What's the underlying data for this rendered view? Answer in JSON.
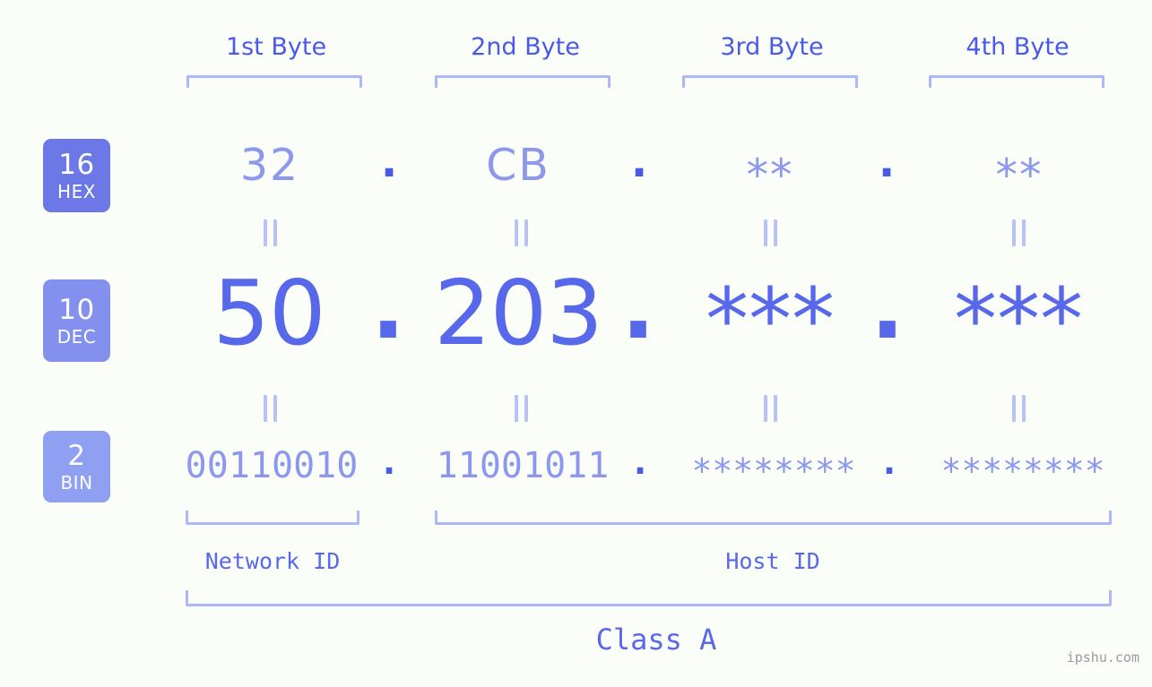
{
  "background_color": "#fbfdf8",
  "colors": {
    "accent_strong": "#4a5ae8",
    "accent_mid": "#5868ea",
    "accent_light": "#8c98ec",
    "bracket": "#aeb8f8",
    "badge_hex": "#6c78e6",
    "badge_dec": "#8490ee",
    "badge_bin": "#8fa0f3",
    "watermark": "#9a9aa2"
  },
  "byte_headers": [
    {
      "label": "1st Byte"
    },
    {
      "label": "2nd Byte"
    },
    {
      "label": "3rd Byte"
    },
    {
      "label": "4th Byte"
    }
  ],
  "rows": {
    "hex": {
      "badge_number": "16",
      "badge_system": "HEX",
      "values": [
        "32",
        "CB",
        "**",
        "**"
      ],
      "separators": [
        ".",
        ".",
        "."
      ]
    },
    "dec": {
      "badge_number": "10",
      "badge_system": "DEC",
      "values": [
        "50",
        "203",
        "***",
        "***"
      ],
      "separators": [
        ".",
        ".",
        "."
      ]
    },
    "bin": {
      "badge_number": "2",
      "badge_system": "BIN",
      "values": [
        "00110010",
        "11001011",
        "********",
        "********"
      ],
      "separators": [
        ".",
        ".",
        "."
      ]
    }
  },
  "equals_symbol": "=",
  "id_labels": {
    "network": "Network ID",
    "host": "Host ID"
  },
  "class_label": "Class A",
  "watermark": "ipshu.com"
}
